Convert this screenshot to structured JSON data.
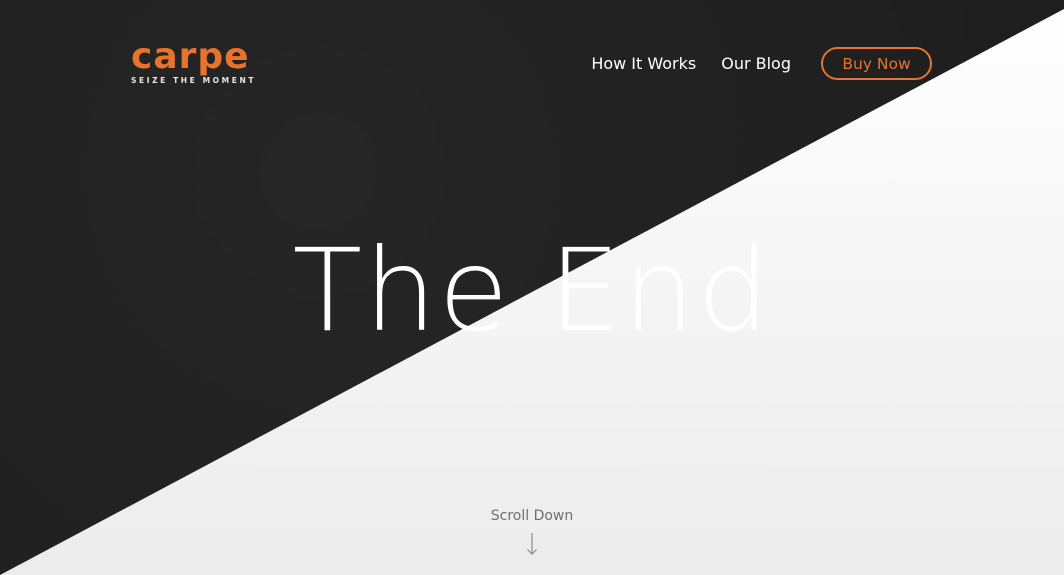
{
  "brand": {
    "name": "carpe",
    "tagline": "SEIZE THE MOMENT",
    "accent": "#e8732d"
  },
  "nav": {
    "items": [
      {
        "label": "How It Works"
      },
      {
        "label": "Our Blog"
      }
    ],
    "cta_label": "Buy Now"
  },
  "hero": {
    "headline": "The End",
    "dark_color": "#1f1f1f",
    "light_color": "#f2f2f2"
  },
  "scroll": {
    "label": "Scroll Down",
    "icon": "arrow-down-icon"
  }
}
